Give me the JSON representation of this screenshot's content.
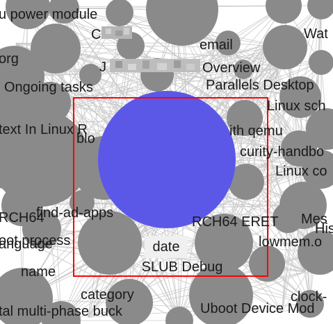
{
  "graph": {
    "colors": {
      "background": "#ffffff",
      "edge": "#c4c4c4",
      "node": "#8a8a8a",
      "focus_node": "#5b58e8",
      "selection": "#ff0000",
      "label_box": "#f0f0f0",
      "label_text": "#1a1a1a"
    },
    "focus_label": "date",
    "focus_caption": "SLUB Debug",
    "labels": [
      "u power module",
      "Wat",
      "email",
      "org",
      "Overview",
      "Ongoing tasks",
      "Parallels Desktop",
      "Linux sch",
      "text In Linux R",
      "blo",
      "ith qemu",
      "curity-handbo",
      "Linux co",
      "RCH64",
      "find-ad-apps",
      "RCH64 ERET",
      "Mes",
      "His",
      "oot process",
      "anguage",
      "lowmem.o",
      "name",
      "category",
      "clock-",
      "tal multi-phase buck",
      "Uboot Device Mod"
    ],
    "redacted_labels": [
      "C",
      "J"
    ]
  }
}
